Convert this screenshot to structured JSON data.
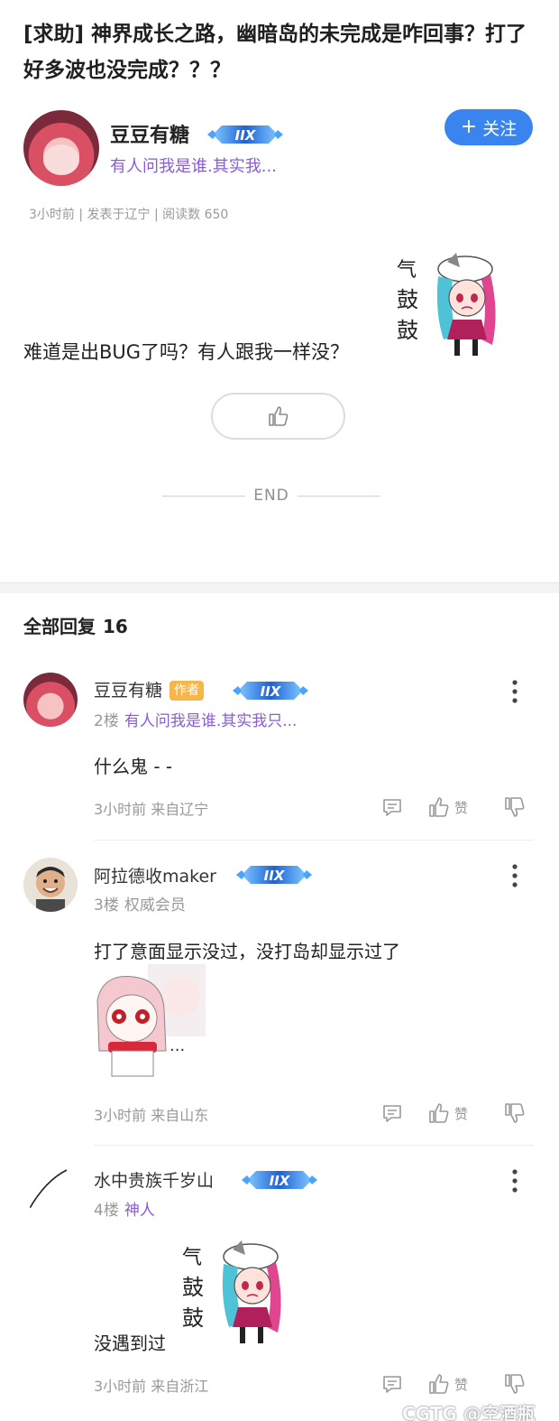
{
  "post": {
    "title": "[求助] 神界成长之路，幽暗岛的未完成是咋回事？打了好多波也没完成？？？",
    "author": {
      "name": "豆豆有糖",
      "badge": "level-badge",
      "signature": "有人问我是谁.其实我..."
    },
    "follow_label": "关注",
    "meta": "3小时前 | 发表于辽宁 | 阅读数 650",
    "body": "难道是出BUG了吗？有人跟我一样没？",
    "sticker_text": "气鼓鼓",
    "end_label": "END"
  },
  "replies_header": {
    "label": "全部回复",
    "count": "16"
  },
  "replies": [
    {
      "name": "豆豆有糖",
      "author_tag": "作者",
      "floor": "2楼",
      "signature": "有人问我是谁.其实我只...",
      "content": "什么鬼 - -",
      "meta": "3小时前 来自辽宁",
      "like_label": "赞"
    },
    {
      "name": "阿拉德收maker",
      "floor": "3楼",
      "signature": "权威会员",
      "content": "打了意面显示没过，没打岛却显示过了",
      "sticker_text": "...",
      "meta": "3小时前 来自山东",
      "like_label": "赞"
    },
    {
      "name": "水中贵族千岁山",
      "floor": "4楼",
      "signature": "神人",
      "content": "没遇到过",
      "sticker_text": "气鼓鼓",
      "meta": "3小时前 来自浙江",
      "like_label": "赞"
    }
  ],
  "watermark": "CGTG @空酒瓶",
  "colors": {
    "accent": "#3a84f0",
    "signature": "#8a5cd6",
    "author_tag": "#f6b64a"
  }
}
